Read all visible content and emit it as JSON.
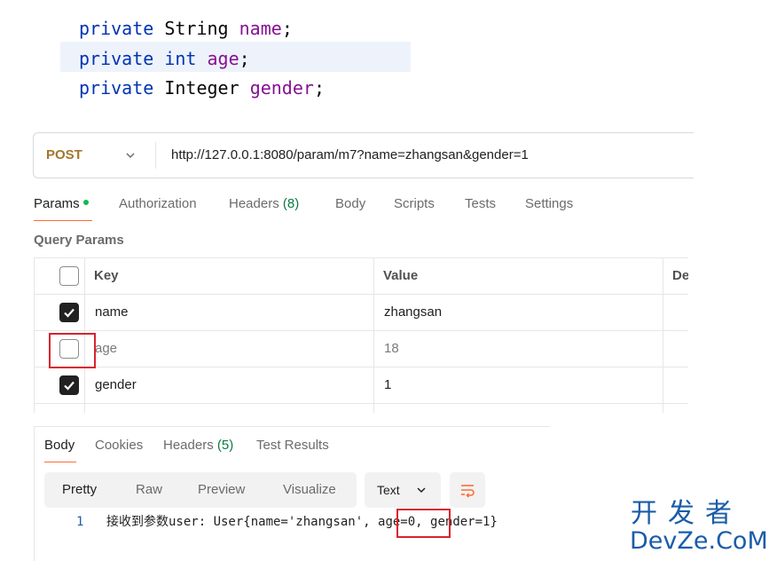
{
  "code": {
    "lines": [
      {
        "keyword": "private",
        "type": "String",
        "field": "name",
        "end": ";"
      },
      {
        "keyword": "private",
        "type": "int",
        "field": "age",
        "end": ";"
      },
      {
        "keyword": "private",
        "type": "Integer",
        "field": "gender",
        "end": ";"
      }
    ]
  },
  "request": {
    "method": "POST",
    "url": "http://127.0.0.1:8080/param/m7?name=zhangsan&gender=1"
  },
  "request_tabs": [
    {
      "label": "Params",
      "active": true,
      "has_dot": true
    },
    {
      "label": "Authorization"
    },
    {
      "label": "Headers",
      "count": "(8)"
    },
    {
      "label": "Body"
    },
    {
      "label": "Scripts"
    },
    {
      "label": "Tests"
    },
    {
      "label": "Settings"
    }
  ],
  "query_params": {
    "title": "Query Params",
    "columns": {
      "key": "Key",
      "value": "Value",
      "description": "De"
    },
    "rows": [
      {
        "key": "name",
        "value": "zhangsan",
        "enabled": true
      },
      {
        "key": "age",
        "value": "18",
        "enabled": false
      },
      {
        "key": "gender",
        "value": "1",
        "enabled": true
      }
    ]
  },
  "response_tabs": [
    {
      "label": "Body",
      "active": true
    },
    {
      "label": "Cookies"
    },
    {
      "label": "Headers",
      "count": "(5)"
    },
    {
      "label": "Test Results"
    }
  ],
  "view_modes": [
    "Pretty",
    "Raw",
    "Preview",
    "Visualize"
  ],
  "active_view_mode": "Pretty",
  "format": "Text",
  "response_body": {
    "line_number": "1",
    "prefix": "接收到参数user: User{name='zhangsan', ",
    "highlight": "age=0",
    "suffix": ", gender=1}"
  },
  "watermark": {
    "top": "开发者",
    "bottom": "DevZe.CoM"
  },
  "colors": {
    "accent": "#ff6c37",
    "method": "#a5762b",
    "annotation": "#d9232e",
    "keyword": "#0033b3",
    "field": "#871094"
  }
}
